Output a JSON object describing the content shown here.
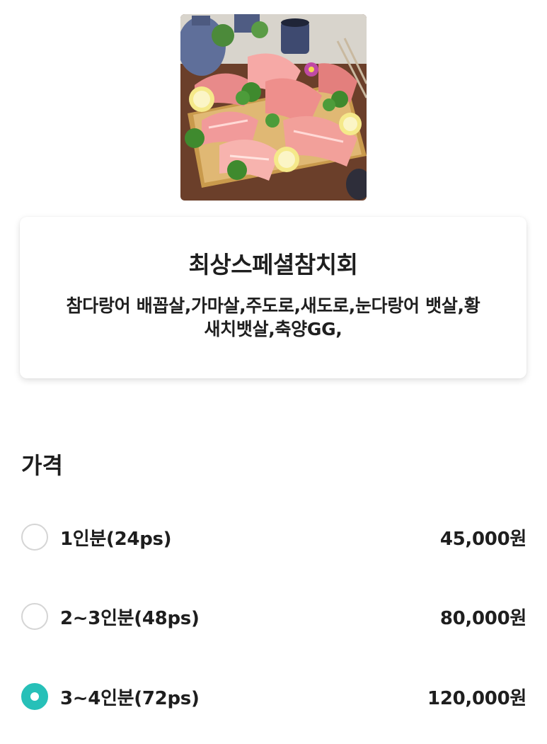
{
  "menu": {
    "title": "최상스페셜참치회",
    "description": "참다랑어 배꼽살,가마살,주도로,새도로,눈다랑어 뱃살,황새치뱃살,축양GG,"
  },
  "price_section": {
    "title": "가격",
    "options": [
      {
        "label": "1인분(24ps)",
        "price": "45,000원",
        "selected": false
      },
      {
        "label": "2~3인분(48ps)",
        "price": "80,000원",
        "selected": false
      },
      {
        "label": "3~4인분(72ps)",
        "price": "120,000원",
        "selected": true
      }
    ]
  },
  "colors": {
    "accent": "#27c0b8",
    "radio_border": "#d5d5d5",
    "text": "#1e1e1e"
  }
}
